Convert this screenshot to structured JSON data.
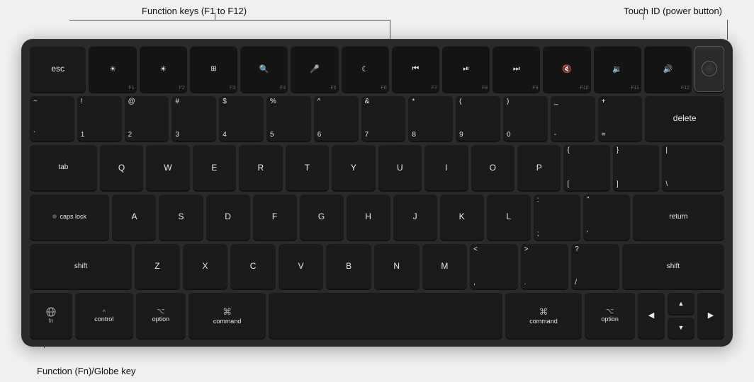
{
  "annotations": {
    "fn_keys": "Function keys (F1 to F12)",
    "touch_id": "Touch ID (power button)",
    "globe_key": "Function (Fn)/Globe key"
  },
  "keyboard": {
    "rows": {
      "fn_row": [
        "esc",
        "F1",
        "F2",
        "F3",
        "F4",
        "F5",
        "F6",
        "F7",
        "F8",
        "F9",
        "F10",
        "F11",
        "F12",
        "⏻"
      ],
      "number_row": [
        {
          "top": "~",
          "bot": "`"
        },
        {
          "top": "!",
          "bot": "1"
        },
        {
          "top": "@",
          "bot": "2"
        },
        {
          "top": "#",
          "bot": "3"
        },
        {
          "top": "$",
          "bot": "4"
        },
        {
          "top": "%",
          "bot": "5"
        },
        {
          "top": "^",
          "bot": "6"
        },
        {
          "top": "&",
          "bot": "7"
        },
        {
          "top": "*",
          "bot": "8"
        },
        {
          "top": "(",
          "bot": "9"
        },
        {
          "top": ")",
          "bot": "0"
        },
        {
          "top": "_",
          "bot": "-"
        },
        {
          "top": "+",
          "bot": "="
        },
        {
          "top": "delete",
          "bot": ""
        }
      ],
      "tab_row": [
        "tab",
        "Q",
        "W",
        "E",
        "R",
        "T",
        "Y",
        "U",
        "I",
        "O",
        "P",
        "{[",
        "]}",
        "|\\ "
      ],
      "caps_row": [
        "caps lock",
        "A",
        "S",
        "D",
        "F",
        "G",
        "H",
        "J",
        "K",
        "L",
        ";:",
        "\"'",
        "return"
      ],
      "shift_row": [
        "shift",
        "Z",
        "X",
        "C",
        "V",
        "B",
        "N",
        "M",
        "<,",
        ">.",
        "?/",
        "shift"
      ],
      "bottom_row": [
        "fn/globe",
        "control",
        "option",
        "command",
        "",
        "command",
        "option",
        "◀",
        "▲▼",
        "▶"
      ]
    }
  }
}
